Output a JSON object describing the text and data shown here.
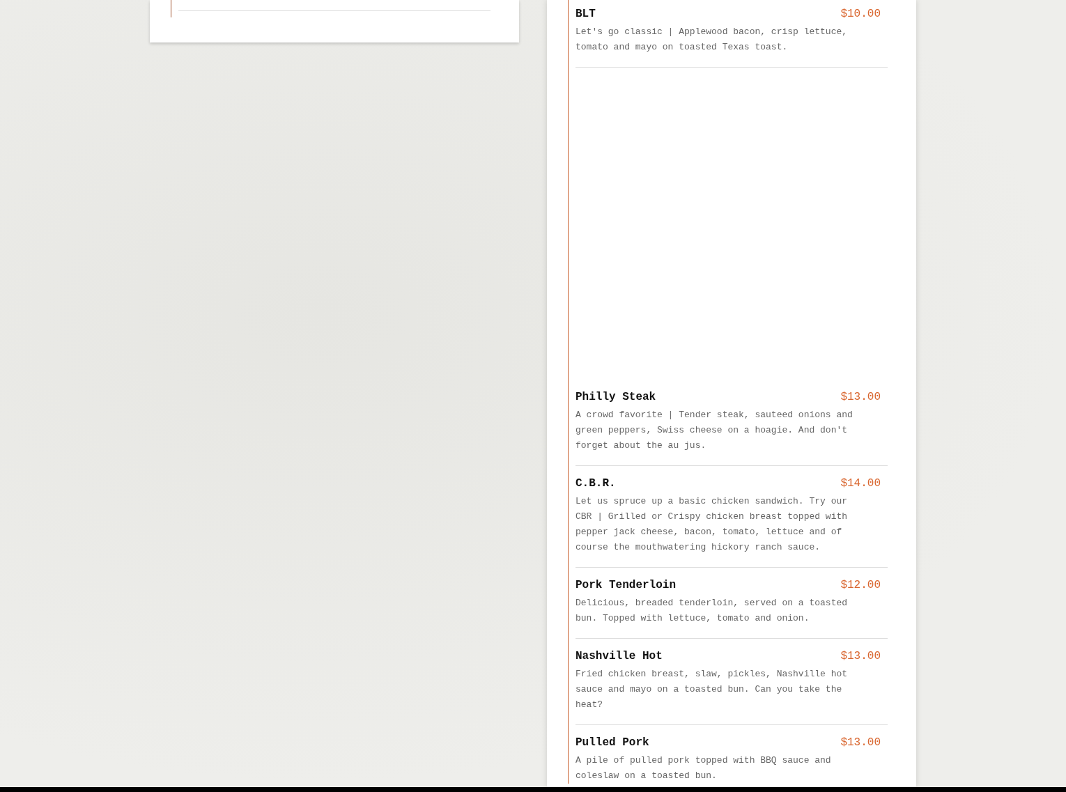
{
  "menu_items": [
    {
      "name": "BLT",
      "price": "$10.00",
      "description": "Let's go classic | Applewood bacon, crisp lettuce, tomato and mayo on toasted Texas toast."
    },
    {
      "name": "Philly Steak",
      "price": "$13.00",
      "description": "A crowd favorite | Tender steak, sauteed onions and green peppers, Swiss cheese on a hoagie. And don't forget about the au jus."
    },
    {
      "name": "C.B.R.",
      "price": "$14.00",
      "description": "Let us spruce up a basic chicken sandwich. Try our CBR | Grilled or Crispy chicken breast topped with pepper jack cheese, bacon, tomato, lettuce and of course the mouthwatering hickory ranch sauce."
    },
    {
      "name": "Pork Tenderloin",
      "price": "$12.00",
      "description": "Delicious, breaded tenderloin, served on a toasted bun. Topped with lettuce, tomato and onion."
    },
    {
      "name": "Nashville Hot",
      "price": "$13.00",
      "description": "Fried chicken breast, slaw, pickles, Nashville hot sauce and mayo on a toasted bun. Can you take the heat?"
    },
    {
      "name": "Pulled Pork",
      "price": "$13.00",
      "description": "A pile of pulled pork topped with BBQ sauce and coleslaw on a toasted bun."
    }
  ]
}
